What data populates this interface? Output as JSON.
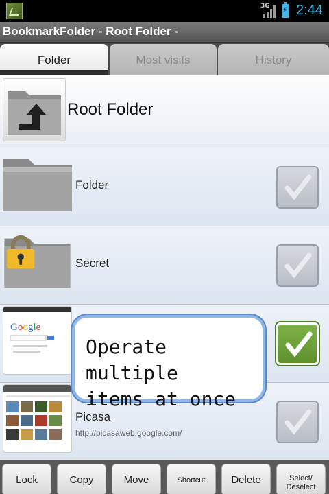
{
  "status_bar": {
    "network": "3G",
    "time": "2:44",
    "icons": [
      "app-thumbnail-icon",
      "signal-icon",
      "battery-charging-icon"
    ]
  },
  "app": {
    "title": "BookmarkFolder - Root Folder -"
  },
  "tabs": [
    {
      "label": "Folder",
      "active": true
    },
    {
      "label": "Most visits",
      "active": false
    },
    {
      "label": "History",
      "active": false
    }
  ],
  "current_folder": {
    "label": "Root Folder",
    "icon": "folder-up-icon"
  },
  "items": [
    {
      "label": "Folder",
      "url": "",
      "icon": "folder-icon",
      "checked": false
    },
    {
      "label": "Secret",
      "url": "",
      "icon": "locked-folder-icon",
      "checked": false
    },
    {
      "label": "",
      "url": "",
      "icon": "google-thumbnail",
      "checked": true
    },
    {
      "label": "Picasa",
      "url": "http://picasaweb.google.com/",
      "icon": "picasa-thumbnail",
      "checked": false
    }
  ],
  "callout": {
    "text": "Operate multiple\nitems at once"
  },
  "toolbar": {
    "buttons": [
      "Lock",
      "Copy",
      "Move",
      "Shortcut",
      "Delete",
      "Select/\nDeselect"
    ]
  },
  "colors": {
    "accent_clock": "#35b5e5",
    "checked_green": "#6aa23a",
    "callout_border": "#8fb8e8"
  }
}
